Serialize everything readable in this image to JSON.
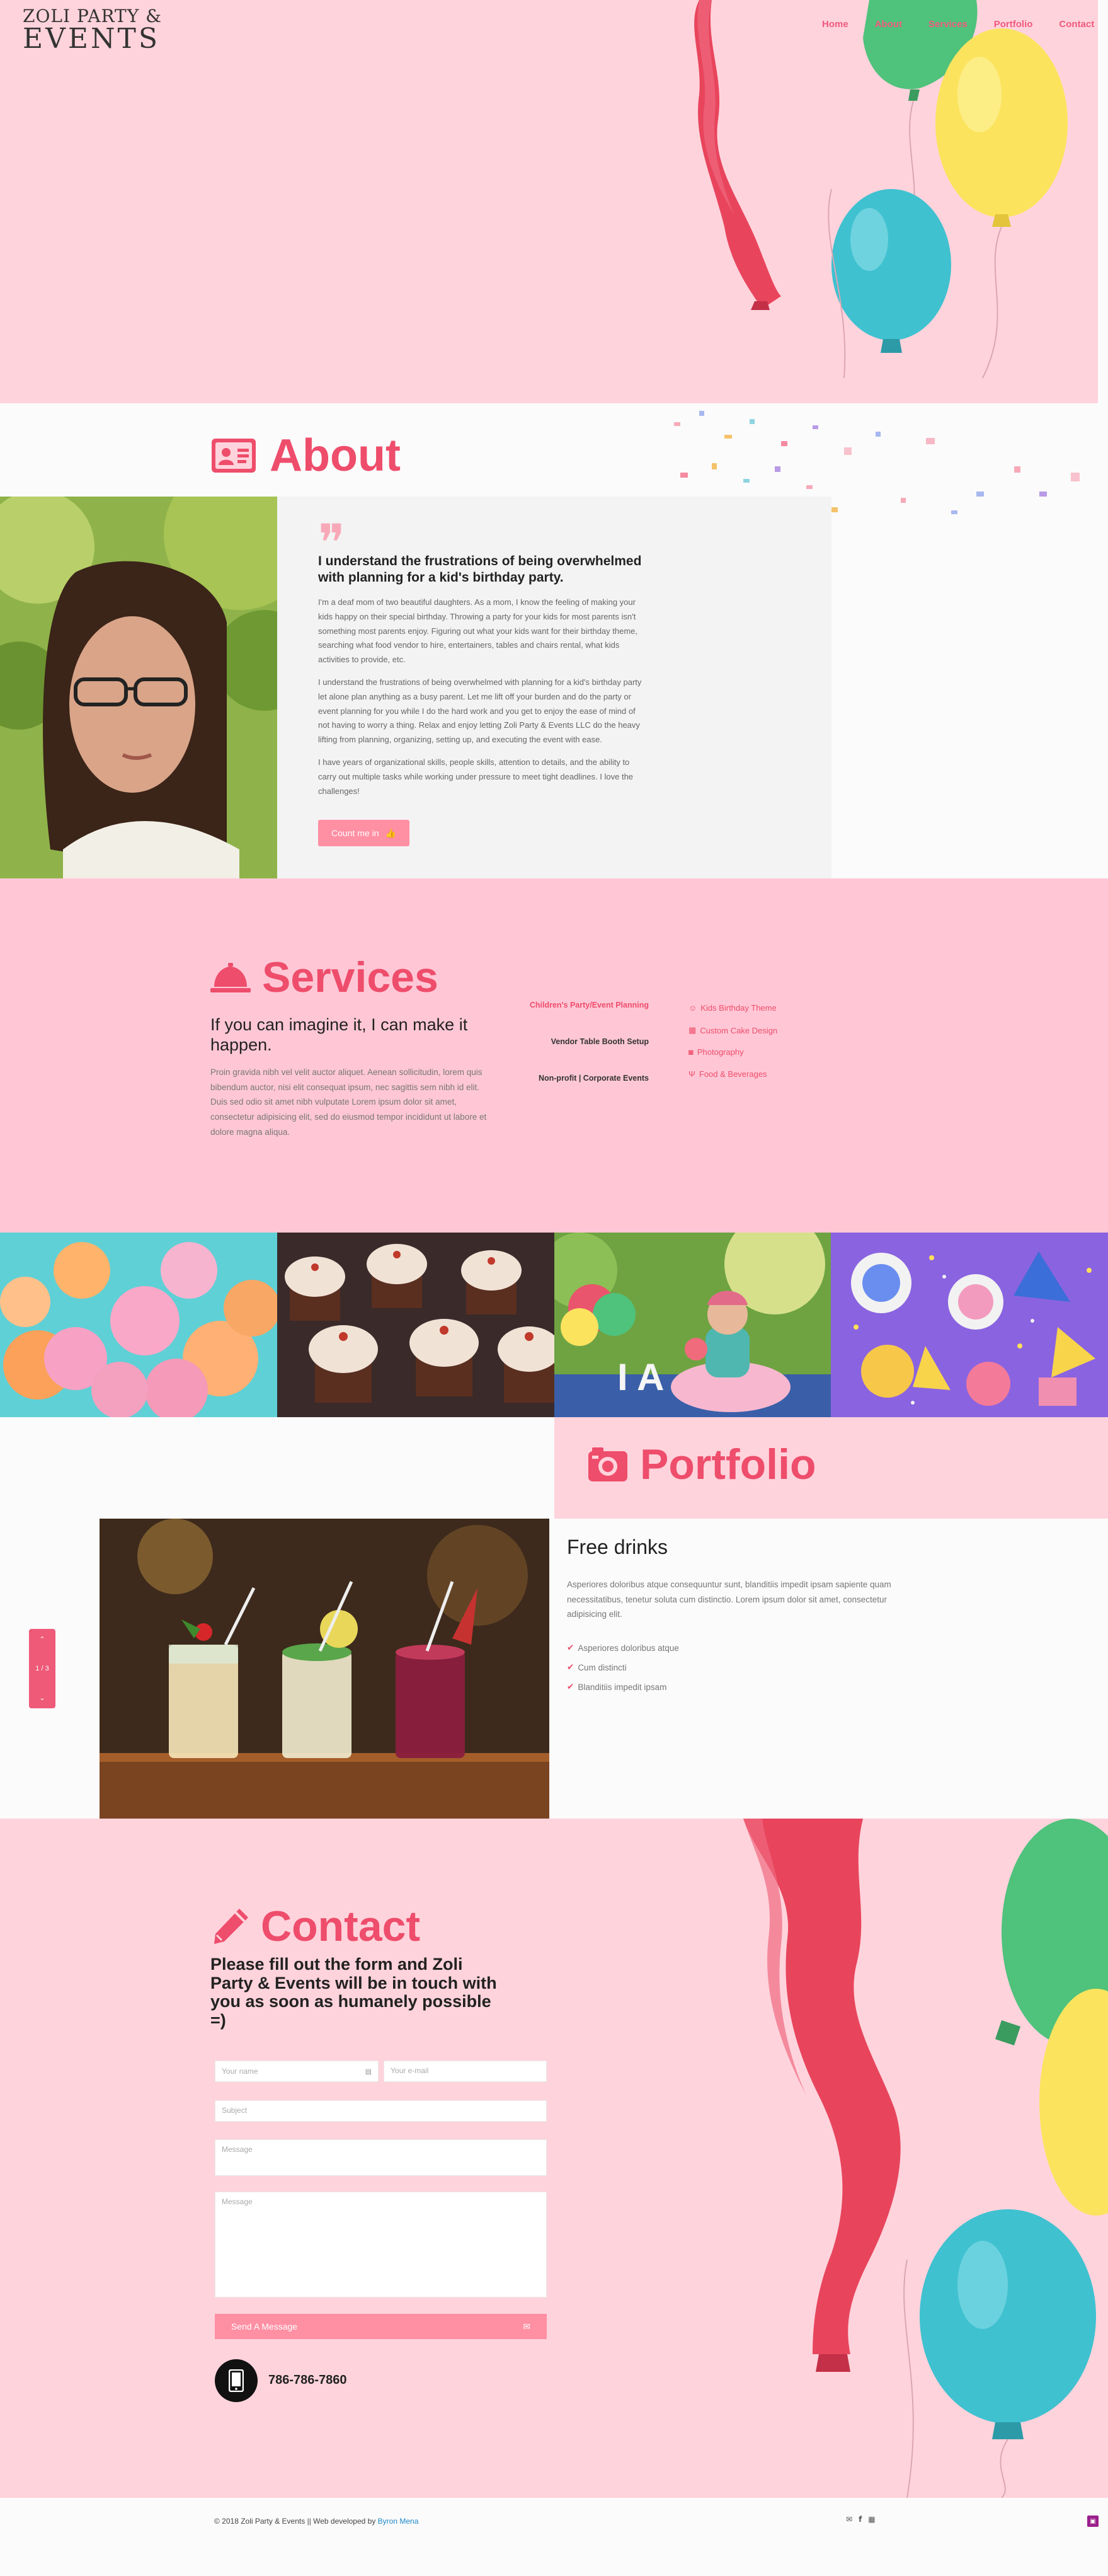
{
  "brand": {
    "logo_line1": "ZOLI PARTY &",
    "logo_line2": "EVENTS"
  },
  "nav": [
    {
      "label": "Home"
    },
    {
      "label": "About"
    },
    {
      "label": "Services"
    },
    {
      "label": "Portfolio"
    },
    {
      "label": "Contact"
    }
  ],
  "about": {
    "title": "About",
    "heading": "I understand the frustrations of being overwhelmed with planning for a kid's birthday party.",
    "paragraphs": [
      "I'm a deaf mom of two beautiful daughters. As a mom, I know the feeling of making your kids happy on their special birthday. Throwing a party for your kids for most parents isn't something most parents enjoy. Figuring out what your kids want for their birthday theme, searching what food vendor to hire, entertainers, tables and chairs rental, what kids activities to provide, etc.",
      "I understand the frustrations of being overwhelmed with planning for a kid's birthday party let alone plan anything as a busy parent. Let me lift off your burden and do the party or event planning for you while I do the hard work and you get to enjoy the ease of mind of not having to worry a thing. Relax and enjoy letting Zoli Party & Events LLC do the heavy lifting from planning, organizing, setting up, and executing the event with ease.",
      "I have years of organizational skills, people skills, attention to details, and the ability to carry out multiple tasks while working under pressure to meet tight deadlines. I love the challenges!"
    ],
    "button_label": "Count me in"
  },
  "services": {
    "title": "Services",
    "subtitle": "If you can imagine it, I can make it happen.",
    "body": "Proin gravida nibh vel velit auctor aliquet. Aenean sollicitudin, lorem quis bibendum auctor, nisi elit consequat ipsum, nec sagittis sem nibh id elit. Duis sed odio sit amet nibh vulputate Lorem ipsum dolor sit amet, consectetur adipisicing elit, sed do eiusmod tempor incididunt ut labore et dolore magna aliqua.",
    "left_items": [
      {
        "label": "Children's Party/Event Planning"
      },
      {
        "label": "Vendor Table Booth Setup"
      },
      {
        "label": "Non-profit | Corporate Events"
      }
    ],
    "right_items": [
      {
        "label": "Kids Birthday Theme",
        "icon": "smile-icon"
      },
      {
        "label": "Custom Cake Design",
        "icon": "cake-icon"
      },
      {
        "label": "Photography",
        "icon": "camera-icon"
      },
      {
        "label": "Food & Beverages",
        "icon": "utensils-icon"
      }
    ]
  },
  "portfolio": {
    "title": "Portfolio",
    "heading": "Free drinks",
    "body": "Asperiores doloribus atque consequuntur sunt, blanditiis impedit ipsam sapiente quam necessitatibus, tenetur soluta cum distinctio. Lorem ipsum dolor sit amet, consectetur adipisicing elit.",
    "list": [
      {
        "label": "Asperiores doloribus atque"
      },
      {
        "label": "Cum distincti"
      },
      {
        "label": "Blanditiis impedit ipsam"
      }
    ],
    "slider_counter": "1 / 3"
  },
  "contact": {
    "title": "Contact",
    "subtitle": "Please fill out the form and Zoli Party & Events will be in touch with you as soon as humanely possible =)",
    "name_placeholder": "Your name",
    "email_placeholder": "Your e-mail",
    "subject_placeholder": "Subject",
    "message_placeholder": "Message",
    "message2_placeholder": "Message",
    "send_label": "Send A Message",
    "phone": "786-786-7860"
  },
  "footer": {
    "copyright": "© 2018 Zoli Party & Events || Web developed by",
    "developer": "Byron Mena"
  },
  "colors": {
    "accent": "#ee4d6b",
    "hero_bg": "#ffd3dc",
    "services_bg": "#ffc7d6",
    "button": "#ff8fa3"
  }
}
